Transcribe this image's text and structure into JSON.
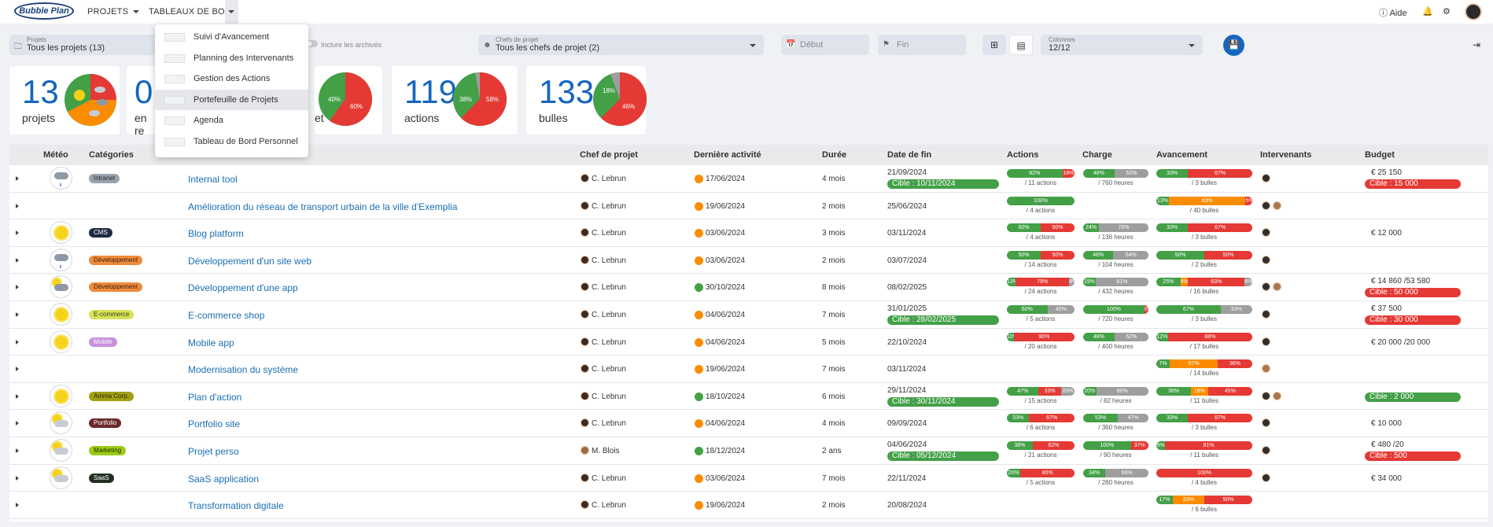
{
  "topbar": {
    "logo": "Bubble Plan",
    "nav_projets": "PROJETS",
    "nav_tableaux": "TABLEAUX DE BORD",
    "aide": "Aide"
  },
  "filters": {
    "projets_label": "Projets",
    "projets_value": "Tous les projets (13)",
    "inclure_archives": "Inclure les archivés",
    "chefs_label": "Chefs de projet",
    "chefs_value": "Tous les chefs de projet (2)",
    "debut_placeholder": "Début",
    "fin_placeholder": "Fin",
    "colonnes_label": "Colonnes",
    "colonnes_value": "12/12"
  },
  "cards": [
    {
      "value": "13",
      "label": "projets"
    },
    {
      "value": "0",
      "label": "en re"
    },
    {
      "value": "",
      "label": "et",
      "pie": [
        "40%",
        "60%"
      ]
    },
    {
      "value": "119",
      "label": "actions",
      "pie": [
        "38%",
        "58%"
      ]
    },
    {
      "value": "133",
      "label": "bulles",
      "pie": [
        "18%",
        "46%"
      ]
    }
  ],
  "menu": {
    "items": [
      "Suivi d'Avancement",
      "Planning des Intervenants",
      "Gestion des Actions",
      "Portefeuille de Projets",
      "Agenda",
      "Tableau de Bord Personnel"
    ]
  },
  "columns": [
    "Météo",
    "Catégories",
    "Chef de projet",
    "Dernière activité",
    "Durée",
    "Date de fin",
    "Actions",
    "Charge",
    "Avancement",
    "Intervenants",
    "Budget"
  ],
  "rows": [
    {
      "name": "Internal tool",
      "chef": "C. Lebrun",
      "activite": "17/06/2024",
      "duree": "4 mois",
      "fin": "21/09/2024",
      "cible": "Cible : 10/11/2024",
      "actions_sub": "/ 11 actions",
      "charge_sub": "/ 760 heures",
      "av_sub": "/ 3 bulles",
      "budget": "€ 25 150",
      "budget_cible": "Cible : 15 000",
      "cat": "Intranet"
    },
    {
      "name": "Amélioration du réseau de transport urbain de la ville d'Exemplia",
      "chef": "C. Lebrun",
      "activite": "19/06/2024",
      "duree": "2 mois",
      "fin": "25/06/2024",
      "actions_sub": "/ 4 actions",
      "av_sub": "/ 40 bulles"
    },
    {
      "name": "Blog platform",
      "chef": "C. Lebrun",
      "activite": "03/06/2024",
      "duree": "3 mois",
      "fin": "03/11/2024",
      "actions_sub": "/ 4 actions",
      "charge_sub": "/ 136 heures",
      "av_sub": "/ 3 bulles",
      "budget": "€ 12 000",
      "cat": "CMS"
    },
    {
      "name": "Développement d'un site web",
      "chef": "C. Lebrun",
      "activite": "03/06/2024",
      "duree": "2 mois",
      "fin": "03/07/2024",
      "actions_sub": "/ 14 actions",
      "charge_sub": "/ 104 heures",
      "av_sub": "/ 2 bulles",
      "cat": "Développement"
    },
    {
      "name": "Développement d'une app",
      "chef": "C. Lebrun",
      "activite": "30/10/2024",
      "duree": "8 mois",
      "fin": "08/02/2025",
      "actions_sub": "/ 24 actions",
      "charge_sub": "/ 432 heures",
      "av_sub": "/ 16 bulles",
      "budget": "€ 14 860 /53 580",
      "budget_cible": "Cible : 50 000",
      "cat": "Développement"
    },
    {
      "name": "E-commerce shop",
      "chef": "C. Lebrun",
      "activite": "04/06/2024",
      "duree": "7 mois",
      "fin": "31/01/2025",
      "cible": "Cible : 28/02/2025",
      "actions_sub": "/ 5 actions",
      "charge_sub": "/ 720 heures",
      "av_sub": "/ 3 bulles",
      "budget": "€ 37 500",
      "budget_cible": "Cible : 30 000",
      "cat": "E-commerce"
    },
    {
      "name": "Mobile app",
      "chef": "C. Lebrun",
      "activite": "04/06/2024",
      "duree": "5 mois",
      "fin": "22/10/2024",
      "actions_sub": "/ 20 actions",
      "charge_sub": "/ 400 heures",
      "av_sub": "/ 17 bulles",
      "budget": "€ 20 000 /20 000",
      "cat": "Mobile"
    },
    {
      "name": "Modernisation du système",
      "chef": "C. Lebrun",
      "activite": "19/06/2024",
      "duree": "7 mois",
      "fin": "03/11/2024",
      "av_sub": "/ 14 bulles"
    },
    {
      "name": "Plan d'action",
      "chef": "C. Lebrun",
      "activite": "18/10/2024",
      "duree": "6 mois",
      "fin": "29/11/2024",
      "cible": "Cible : 30/11/2024",
      "actions_sub": "/ 15 actions",
      "charge_sub": "/ 82 heures",
      "av_sub": "/ 11 bulles",
      "budget_cible": "Cible : 2 000",
      "cat": "Amma Corp."
    },
    {
      "name": "Portfolio site",
      "chef": "C. Lebrun",
      "activite": "04/06/2024",
      "duree": "4 mois",
      "fin": "09/09/2024",
      "actions_sub": "/ 6 actions",
      "charge_sub": "/ 360 heures",
      "av_sub": "/ 3 bulles",
      "budget": "€ 10 000",
      "cat": "Portfolio"
    },
    {
      "name": "Projet perso",
      "chef": "M. Blois",
      "activite": "18/12/2024",
      "duree": "2 ans",
      "fin": "04/06/2024",
      "cible": "Cible : 05/12/2024",
      "actions_sub": "/ 21 actions",
      "charge_sub": "/ 90 heures",
      "av_sub": "/ 11 bulles",
      "budget": "€ 480 /20",
      "budget_cible": "Cible : 500",
      "cat": "Marketing"
    },
    {
      "name": "SaaS application",
      "chef": "C. Lebrun",
      "activite": "03/06/2024",
      "duree": "7 mois",
      "fin": "22/11/2024",
      "actions_sub": "/ 5 actions",
      "charge_sub": "/ 280 heures",
      "av_sub": "/ 4 bulles",
      "budget": "€ 34 000",
      "cat": "SaaS"
    },
    {
      "name": "Transformation digitale",
      "chef": "C. Lebrun",
      "activite": "19/06/2024",
      "duree": "2 mois",
      "fin": "20/08/2024",
      "av_sub": "/ 6 bulles"
    }
  ],
  "bars": {
    "actions": [
      [
        [
          "82%",
          82,
          "#43a047"
        ],
        [
          "18%",
          18,
          "#e53935"
        ]
      ],
      [
        [
          "100%",
          100,
          "#43a047"
        ]
      ],
      [
        [
          "50%",
          50,
          "#43a047"
        ],
        [
          "50%",
          50,
          "#e53935"
        ]
      ],
      [
        [
          "50%",
          50,
          "#43a047"
        ],
        [
          "50%",
          50,
          "#e53935"
        ]
      ],
      [
        [
          "13%",
          13,
          "#43a047"
        ],
        [
          "79%",
          79,
          "#e53935"
        ],
        [
          "8%",
          8,
          "#9e9e9e"
        ]
      ],
      [
        [
          "60%",
          60,
          "#43a047"
        ],
        [
          "40%",
          40,
          "#9e9e9e"
        ]
      ],
      [
        [
          "10%",
          10,
          "#43a047"
        ],
        [
          "90%",
          90,
          "#e53935"
        ]
      ],
      null,
      [
        [
          "47%",
          47,
          "#43a047"
        ],
        [
          "33%",
          33,
          "#e53935"
        ],
        [
          "20%",
          20,
          "#9e9e9e"
        ]
      ],
      [
        [
          "33%",
          33,
          "#43a047"
        ],
        [
          "67%",
          67,
          "#e53935"
        ]
      ],
      [
        [
          "38%",
          38,
          "#43a047"
        ],
        [
          "62%",
          62,
          "#e53935"
        ]
      ],
      [
        [
          "20%",
          20,
          "#43a047"
        ],
        [
          "80%",
          80,
          "#e53935"
        ]
      ],
      null
    ],
    "charge": [
      [
        [
          "48%",
          48,
          "#43a047"
        ],
        [
          "52%",
          52,
          "#9e9e9e"
        ]
      ],
      null,
      [
        [
          "24%",
          24,
          "#43a047"
        ],
        [
          "76%",
          76,
          "#9e9e9e"
        ]
      ],
      [
        [
          "46%",
          46,
          "#43a047"
        ],
        [
          "54%",
          54,
          "#9e9e9e"
        ]
      ],
      [
        [
          "19%",
          19,
          "#43a047"
        ],
        [
          "81%",
          81,
          "#9e9e9e"
        ]
      ],
      [
        [
          "100%",
          94,
          "#43a047"
        ],
        [
          "6%",
          6,
          "#e53935"
        ]
      ],
      [
        [
          "48%",
          48,
          "#43a047"
        ],
        [
          "52%",
          52,
          "#9e9e9e"
        ]
      ],
      null,
      [
        [
          "20%",
          20,
          "#43a047"
        ],
        [
          "80%",
          80,
          "#9e9e9e"
        ]
      ],
      [
        [
          "53%",
          53,
          "#43a047"
        ],
        [
          "47%",
          47,
          "#9e9e9e"
        ]
      ],
      [
        [
          "100%",
          73,
          "#43a047"
        ],
        [
          "37%",
          27,
          "#e53935"
        ]
      ],
      [
        [
          "34%",
          34,
          "#43a047"
        ],
        [
          "66%",
          66,
          "#9e9e9e"
        ]
      ],
      null
    ],
    "avancement": [
      [
        [
          "33%",
          33,
          "#43a047"
        ],
        [
          "67%",
          67,
          "#e53935"
        ]
      ],
      [
        [
          "13%",
          13,
          "#43a047"
        ],
        [
          "83%",
          80,
          "#fb8c00"
        ],
        [
          "5%",
          7,
          "#e53935"
        ]
      ],
      [
        [
          "33%",
          33,
          "#43a047"
        ],
        [
          "67%",
          67,
          "#e53935"
        ]
      ],
      [
        [
          "50%",
          50,
          "#43a047"
        ],
        [
          "50%",
          50,
          "#e53935"
        ]
      ],
      [
        [
          "25%",
          25,
          "#43a047"
        ],
        [
          "8%",
          8,
          "#fb8c00"
        ],
        [
          "63%",
          59,
          "#e53935"
        ],
        [
          "6%",
          8,
          "#9e9e9e"
        ]
      ],
      [
        [
          "67%",
          67,
          "#43a047"
        ],
        [
          "33%",
          33,
          "#9e9e9e"
        ]
      ],
      [
        [
          "12%",
          12,
          "#43a047"
        ],
        [
          "88%",
          88,
          "#e53935"
        ]
      ],
      [
        [
          "7%",
          14,
          "#43a047"
        ],
        [
          "57%",
          50,
          "#fb8c00"
        ],
        [
          "36%",
          36,
          "#e53935"
        ]
      ],
      [
        [
          "36%",
          36,
          "#43a047"
        ],
        [
          "18%",
          18,
          "#fb8c00"
        ],
        [
          "45%",
          46,
          "#e53935"
        ]
      ],
      [
        [
          "33%",
          33,
          "#43a047"
        ],
        [
          "67%",
          67,
          "#e53935"
        ]
      ],
      [
        [
          "9%",
          9,
          "#43a047"
        ],
        [
          "91%",
          91,
          "#e53935"
        ]
      ],
      [
        [
          "100%",
          100,
          "#e53935"
        ]
      ],
      [
        [
          "17%",
          17,
          "#43a047"
        ],
        [
          "33%",
          33,
          "#fb8c00"
        ],
        [
          "50%",
          50,
          "#e53935"
        ]
      ]
    ]
  },
  "meta": {
    "meteo": [
      "storm",
      "none",
      "sun",
      "storm",
      "cloud-dark",
      "sun",
      "sun",
      "none",
      "sun",
      "cloud",
      "cloud",
      "cloud",
      "none"
    ],
    "cat_colors": {
      "Intranet": [
        "#9aa3ad",
        "#1f2a36"
      ],
      "CMS": [
        "#1f2a44",
        "#fff"
      ],
      "Développement": [
        "#f08a3c",
        "#3a2210"
      ],
      "E-commerce": [
        "#d6e25a",
        "#3a3a10"
      ],
      "Mobile": [
        "#c791dc",
        "#fff"
      ],
      "Amma Corp.": [
        "#a0a014",
        "#2a2a00"
      ],
      "Portfolio": [
        "#6b2a2a",
        "#fff"
      ],
      "Marketing": [
        "#9ccc18",
        "#1f2a00"
      ],
      "SaaS": [
        "#1f3020",
        "#fff"
      ]
    },
    "activity_colors": [
      "#fb8c00",
      "#fb8c00",
      "#fb8c00",
      "#fb8c00",
      "#43a047",
      "#fb8c00",
      "#fb8c00",
      "#fb8c00",
      "#43a047",
      "#fb8c00",
      "#43a047",
      "#fb8c00",
      "#fb8c00"
    ],
    "interv": [
      [
        "dark"
      ],
      [
        "dark",
        "alt"
      ],
      [
        "dark"
      ],
      [
        "dark"
      ],
      [
        "dark",
        "alt"
      ],
      [
        "dark"
      ],
      [
        "dark"
      ],
      [
        "alt"
      ],
      [
        "dark",
        "alt"
      ],
      [
        "dark"
      ],
      [
        "dark"
      ],
      [
        "dark"
      ],
      []
    ]
  }
}
